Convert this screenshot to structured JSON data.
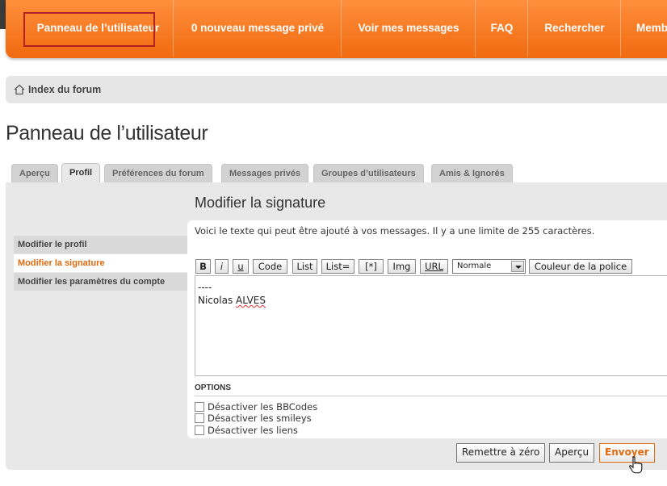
{
  "navbar": {
    "items": [
      {
        "label": "Panneau de l’utilisateur"
      },
      {
        "label": "0 nouveau message privé"
      },
      {
        "label": "Voir mes messages"
      },
      {
        "label": "FAQ"
      },
      {
        "label": "Rechercher"
      },
      {
        "label": "Memb"
      }
    ],
    "accent": "#f27519"
  },
  "breadcrumb": {
    "icon": "home-icon",
    "label": "Index du forum"
  },
  "page_title": "Panneau de l’utilisateur",
  "tabs": [
    {
      "label": "Aperçu",
      "active": false
    },
    {
      "label": "Profil",
      "active": true
    },
    {
      "label": "Préférences du forum",
      "active": false
    },
    {
      "label": "Messages privés",
      "active": false
    },
    {
      "label": "Groupes d’utilisateurs",
      "active": false
    },
    {
      "label": "Amis & Ignorés",
      "active": false
    }
  ],
  "side_menu": [
    {
      "label": "Modifier le profil",
      "active": false
    },
    {
      "label": "Modifier la signature",
      "active": true
    },
    {
      "label": "Modifier les paramètres du compte",
      "active": false
    }
  ],
  "section_title": "Modifier la signature",
  "explain": "Voici le texte qui peut être ajouté à vos messages. Il y a une limite de 255 caractères.",
  "toolbar": {
    "bold": "B",
    "italic": "i",
    "underline": "u",
    "code": "Code",
    "list": "List",
    "list_eq": "List=",
    "star": "[*]",
    "img": "Img",
    "url": "URL",
    "font_size_selected": "Normale",
    "font_color": "Couleur de la police"
  },
  "signature": {
    "line1": "----",
    "first_name": "Nicolas ",
    "last_name": "ALVES"
  },
  "options": {
    "label": "OPTIONS",
    "items": [
      {
        "label": "Désactiver les BBCodes",
        "checked": false
      },
      {
        "label": "Désactiver les smileys",
        "checked": false
      },
      {
        "label": "Désactiver les liens",
        "checked": false
      }
    ]
  },
  "buttons": {
    "reset": "Remettre à zéro",
    "preview": "Aperçu",
    "submit": "Envoyer"
  }
}
